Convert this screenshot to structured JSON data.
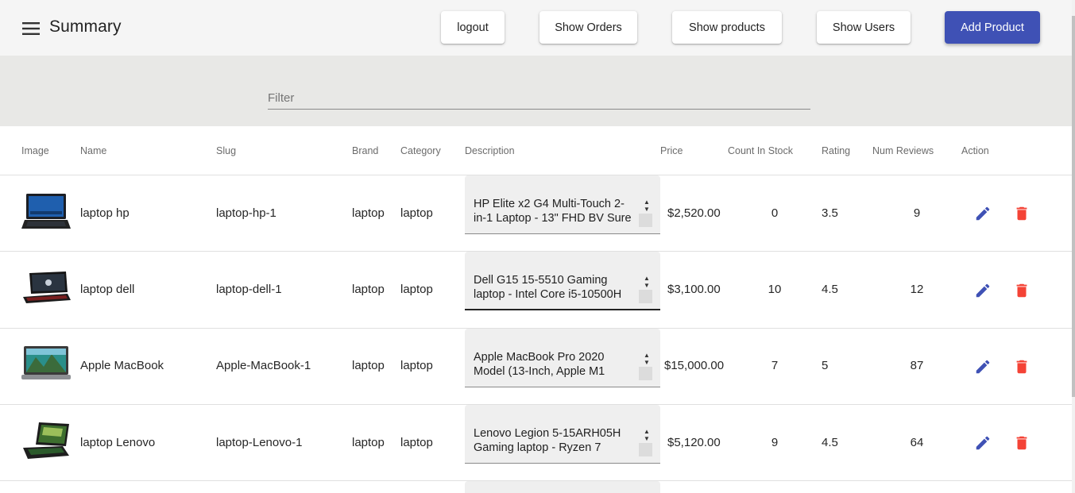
{
  "header": {
    "title": "Summary",
    "buttons": {
      "logout": "logout",
      "show_orders": "Show Orders",
      "show_products": "Show products",
      "show_users": "Show Users",
      "add_product": "Add Product"
    }
  },
  "filter": {
    "placeholder": "Filter",
    "value": ""
  },
  "table": {
    "columns": [
      "Image",
      "Name",
      "Slug",
      "Brand",
      "Category",
      "Description",
      "Price",
      "Count In Stock",
      "Rating",
      "Num Reviews",
      "Action"
    ],
    "rows": [
      {
        "name": "laptop hp",
        "slug": "laptop-hp-1",
        "brand": "laptop",
        "category": "laptop",
        "description": "HP Elite x2 G4 Multi-Touch 2-in-1 Laptop - 13\" FHD BV Sure",
        "price": "$2,520.00",
        "count_in_stock": "0",
        "rating": "3.5",
        "num_reviews": "9",
        "image_icon": "laptop-hp-thumbnail"
      },
      {
        "name": "laptop dell",
        "slug": "laptop-dell-1",
        "brand": "laptop",
        "category": "laptop",
        "description": "Dell G15 15-5510 Gaming laptop - Intel Core i5-10500H",
        "price": "$3,100.00",
        "count_in_stock": "10",
        "rating": "4.5",
        "num_reviews": "12",
        "image_icon": "laptop-dell-thumbnail"
      },
      {
        "name": "Apple MacBook",
        "slug": "Apple-MacBook-1",
        "brand": "laptop",
        "category": "laptop",
        "description": "Apple MacBook Pro 2020 Model (13-Inch, Apple M1",
        "price": "$15,000.00",
        "count_in_stock": "7",
        "rating": "5",
        "num_reviews": "87",
        "image_icon": "laptop-macbook-thumbnail"
      },
      {
        "name": "laptop Lenovo",
        "slug": "laptop-Lenovo-1",
        "brand": "laptop",
        "category": "laptop",
        "description": "Lenovo Legion 5-15ARH05H Gaming laptop - Ryzen 7",
        "price": "$5,120.00",
        "count_in_stock": "9",
        "rating": "4.5",
        "num_reviews": "64",
        "image_icon": "laptop-lenovo-thumbnail"
      }
    ]
  },
  "colors": {
    "primary": "#3f51b5",
    "edit_icon": "#3f51b5",
    "delete_icon": "#f44336",
    "appbar_bg": "#f5f5f5",
    "filter_bg": "#e8e8e6"
  }
}
